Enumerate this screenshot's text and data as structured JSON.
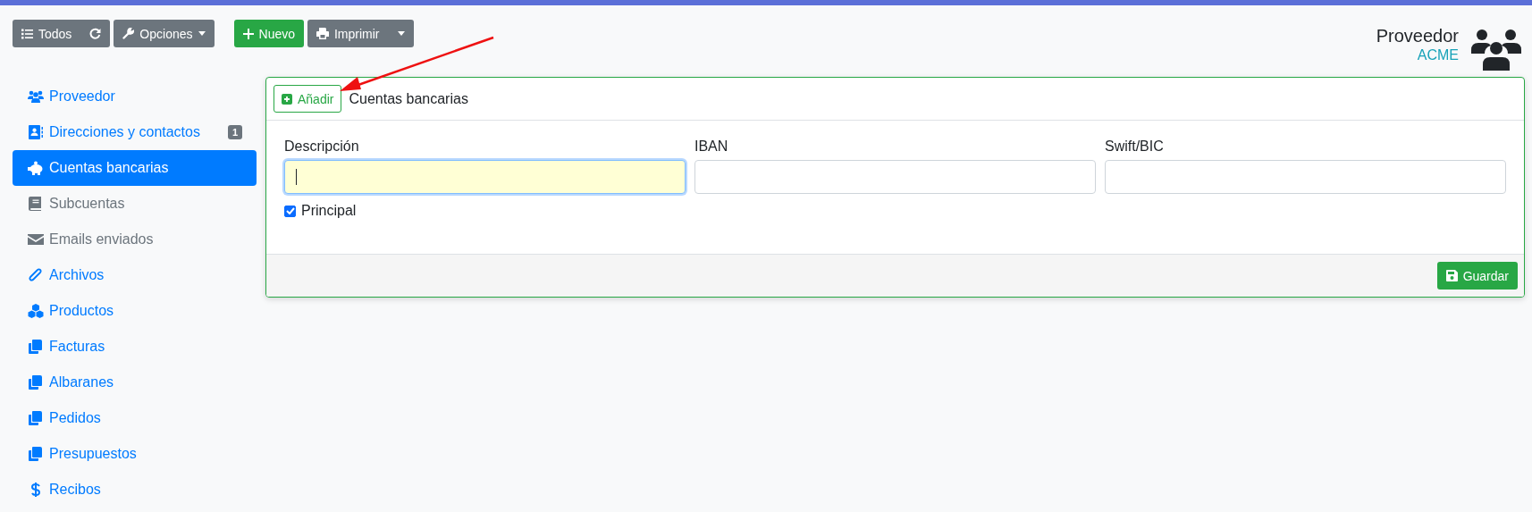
{
  "toolbar": {
    "buttons": [
      {
        "kind": "list",
        "label": "Todos"
      },
      {
        "kind": "options",
        "label": "Opciones"
      },
      {
        "kind": "new",
        "label": "Nuevo"
      },
      {
        "kind": "print",
        "label": "Imprimir"
      }
    ]
  },
  "header": {
    "title": "Proveedor",
    "subtitle": "ACME"
  },
  "sidebar": {
    "items": [
      {
        "label": "Proveedor",
        "selected": false,
        "disabled": false
      },
      {
        "label": "Direcciones y contactos",
        "selected": false,
        "disabled": false,
        "badge": "1"
      },
      {
        "label": "Cuentas bancarias",
        "selected": true,
        "disabled": false
      },
      {
        "label": "Subcuentas",
        "selected": false,
        "disabled": true
      },
      {
        "label": "Emails enviados",
        "selected": false,
        "disabled": true
      },
      {
        "label": "Archivos",
        "selected": false,
        "disabled": false
      },
      {
        "label": "Productos",
        "selected": false,
        "disabled": false
      },
      {
        "label": "Facturas",
        "selected": false,
        "disabled": false
      },
      {
        "label": "Albaranes",
        "selected": false,
        "disabled": false
      },
      {
        "label": "Pedidos",
        "selected": false,
        "disabled": false
      },
      {
        "label": "Presupuestos",
        "selected": false,
        "disabled": false
      },
      {
        "label": "Recibos",
        "selected": false,
        "disabled": false
      }
    ]
  },
  "panel": {
    "add_button": "Añadir",
    "title": "Cuentas bancarias",
    "fields": [
      {
        "label": "Descripción",
        "focused": true
      },
      {
        "label": "IBAN",
        "focused": false
      },
      {
        "label": "Swift/BIC",
        "focused": false
      }
    ],
    "checkbox": {
      "label": "Principal",
      "checked": true
    },
    "save_button": "Guardar"
  }
}
